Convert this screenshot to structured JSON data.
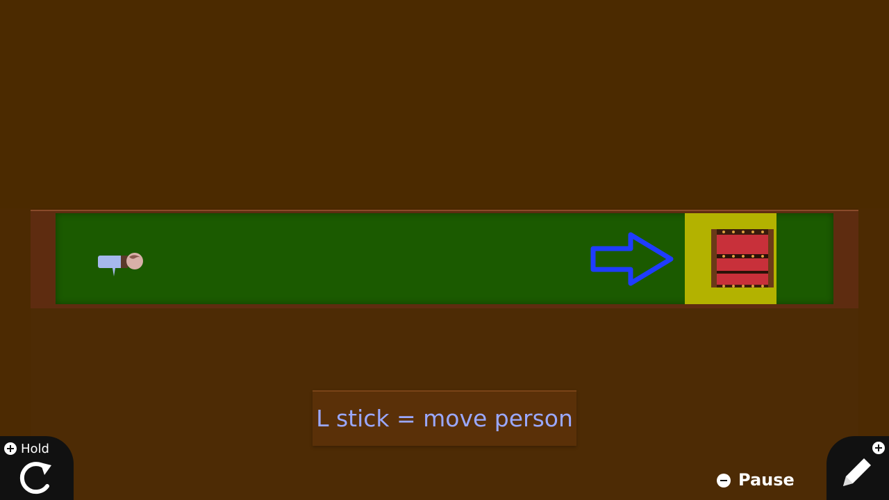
{
  "hint": {
    "text": "L stick = move person"
  },
  "hold": {
    "label": "Hold",
    "icon": "rotate-icon"
  },
  "pause": {
    "label": "Pause",
    "icon": "minus-icon"
  },
  "edit": {
    "icon": "pencil-icon"
  },
  "scene": {
    "player": "person",
    "goal": "treasure-chest",
    "direction": "right-arrow"
  },
  "colors": {
    "background": "#4a2900",
    "corridor": "#1b5a00",
    "goal_tile": "#b3b200",
    "arrow": "#1f3cff",
    "hint_text": "#9aa8ff"
  }
}
